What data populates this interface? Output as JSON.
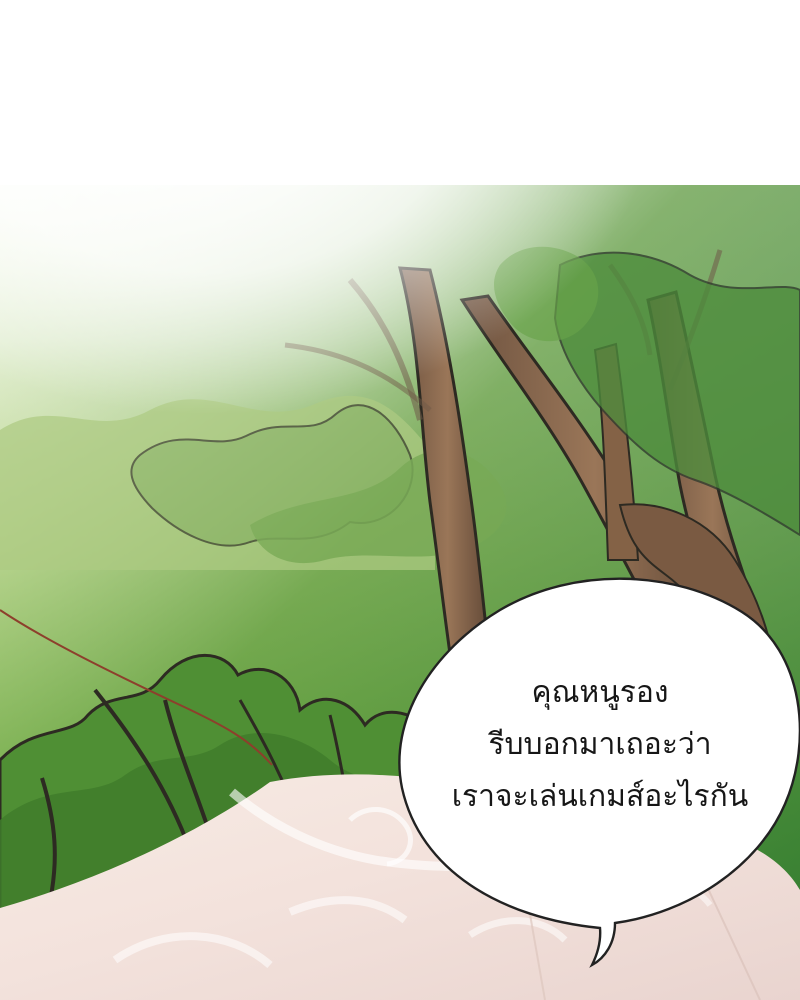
{
  "comic_panel": {
    "speech_bubble": {
      "lines": [
        "คุณหนูรอง",
        "รีบบอกมาเถอะว่า",
        "เราจะเล่นเกมส์อะไรกัน"
      ]
    },
    "colors": {
      "sky_white": "#ffffff",
      "forest_green": "#4f8f34",
      "light_green": "#b7db6a",
      "tree_bark": "#8b6a4e",
      "ink_outline": "#2d2a22",
      "robe_pink": "#f3e2dc"
    }
  }
}
